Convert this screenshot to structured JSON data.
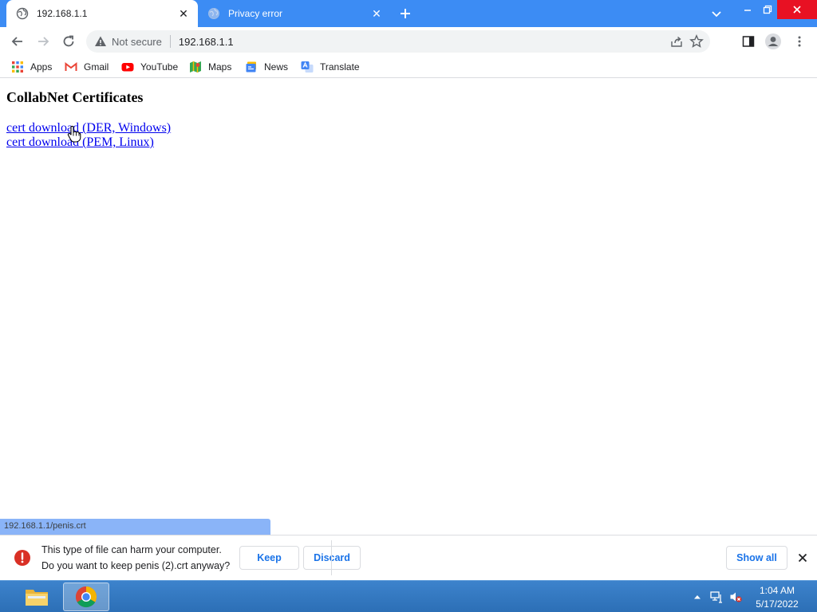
{
  "browser": {
    "tabs": [
      {
        "title": "192.168.1.1",
        "close": "✕"
      },
      {
        "title": "Privacy error",
        "close": "✕"
      }
    ],
    "new_tab_symbol": "+"
  },
  "omnibox": {
    "security_label": "Not secure",
    "url": "192.168.1.1"
  },
  "bookmarks": [
    {
      "label": "Apps",
      "icon": "apps-grid-icon"
    },
    {
      "label": "Gmail",
      "icon": "gmail-icon"
    },
    {
      "label": "YouTube",
      "icon": "youtube-icon"
    },
    {
      "label": "Maps",
      "icon": "maps-icon"
    },
    {
      "label": "News",
      "icon": "news-icon"
    },
    {
      "label": "Translate",
      "icon": "translate-icon"
    }
  ],
  "page": {
    "title": "CollabNet Certificates",
    "links": [
      {
        "text": "cert download (DER, Windows)"
      },
      {
        "text": "cert download (PEM, Linux)"
      }
    ]
  },
  "status_bar": {
    "url": "192.168.1.1/penis.crt"
  },
  "download_shelf": {
    "warning_line1": "This type of file can harm your computer.",
    "warning_line2": "Do you want to keep penis (2).crt anyway?",
    "keep_label": "Keep",
    "discard_label": "Discard",
    "show_all_label": "Show all"
  },
  "taskbar": {
    "time": "1:04 AM",
    "date": "5/17/2022"
  },
  "colors": {
    "tabstrip": "#3c8cf4",
    "link": "#0000ee",
    "accent_button_text": "#1a73e8",
    "warning_red": "#d93025",
    "taskbar": "#2c6fb6"
  }
}
